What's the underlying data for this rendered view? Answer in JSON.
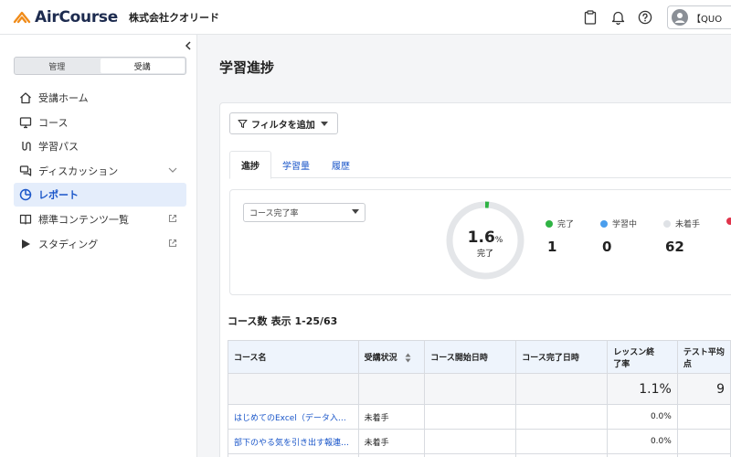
{
  "header": {
    "brand": "AirCourse",
    "company": "株式会社クオリード",
    "user_label": "【QUO"
  },
  "sidebar": {
    "role_tabs": [
      {
        "label": "管理",
        "active": false
      },
      {
        "label": "受講",
        "active": true
      }
    ],
    "items": [
      {
        "label": "受講ホーム",
        "icon": "home-icon"
      },
      {
        "label": "コース",
        "icon": "monitor-icon"
      },
      {
        "label": "学習パス",
        "icon": "path-icon"
      },
      {
        "label": "ディスカッション",
        "icon": "chat-icon",
        "trail": "chevron-down-icon"
      },
      {
        "label": "レポート",
        "icon": "report-icon",
        "active": true
      },
      {
        "label": "標準コンテンツ一覧",
        "icon": "book-icon",
        "trail": "external-link-icon"
      },
      {
        "label": "スタディング",
        "icon": "play-icon",
        "trail": "external-link-icon"
      }
    ]
  },
  "main": {
    "title": "学習進捗",
    "filter_label": "フィルタを追加",
    "tabs": [
      {
        "label": "進捗",
        "active": true
      },
      {
        "label": "学習量"
      },
      {
        "label": "履歴"
      }
    ],
    "metric_select": "コース完了率",
    "donut": {
      "value": "1.6",
      "unit": "%",
      "label": "完了",
      "fraction": 0.016
    },
    "legend": [
      {
        "label": "完了",
        "value": "1",
        "color": "#2fb344"
      },
      {
        "label": "学習中",
        "value": "0",
        "color": "#4a9eed"
      },
      {
        "label": "未着手",
        "value": "62",
        "color": "#dfe2e6"
      },
      {
        "label": "",
        "value": "",
        "color": "#e0344b"
      }
    ],
    "count_label": "コース数",
    "count_display": "表示 1-25/63"
  },
  "table": {
    "headers": [
      "コース名",
      "受講状況",
      "コース開始日時",
      "コース完了日時",
      "レッスン終了率",
      "テスト平均点"
    ],
    "header_lines": {
      "lesson": [
        "レッスン終",
        "了率"
      ],
      "test": [
        "テスト平均",
        "点"
      ]
    },
    "summary": {
      "lesson": "1.1%",
      "test": "9"
    },
    "rows": [
      {
        "name": "はじめてのExcel（データ入…",
        "status": "未着手",
        "start": "",
        "end": "",
        "lesson": "0.0%"
      },
      {
        "name": "部下のやる気を引き出す報連…",
        "status": "未着手",
        "start": "",
        "end": "",
        "lesson": "0.0%"
      }
    ]
  }
}
